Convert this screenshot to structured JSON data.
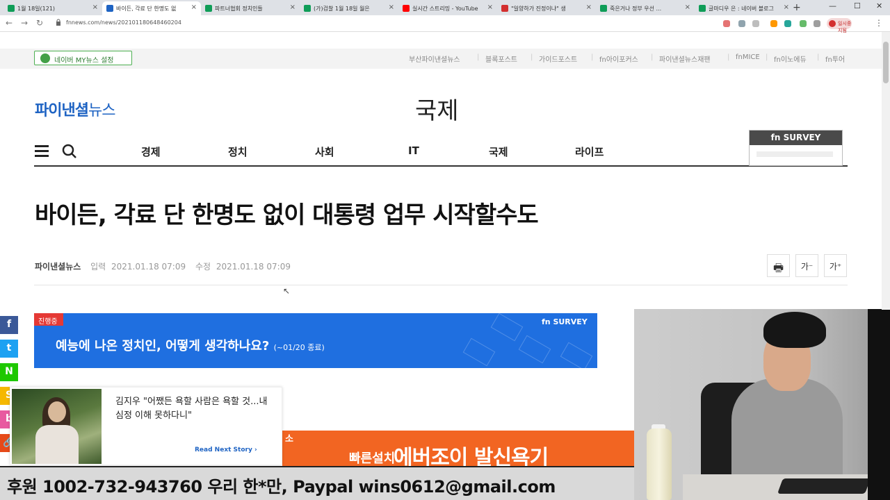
{
  "browser": {
    "tabs": [
      {
        "label": "1월 18일(121)",
        "color": "#0f9d58"
      },
      {
        "label": "바이든, 각료 단 한명도 없",
        "color": "#1e63c3",
        "active": true
      },
      {
        "label": "파트너협회 정치인들",
        "color": "#0f9d58"
      },
      {
        "label": "(가)검찰 1월 18일 월은",
        "color": "#0f9d58"
      },
      {
        "label": "실시간 스트리밍 - YouTube",
        "color": "#ff0000"
      },
      {
        "label": "\"일양하가 진정이냐\" 생",
        "color": "#d32f2f"
      },
      {
        "label": "죽은거나 정부 우선 ...",
        "color": "#0f9d58"
      },
      {
        "label": "글마디우 은 : 네이버 블로그",
        "color": "#0f9d58"
      }
    ],
    "new_tab": "+",
    "url": "fnnews.com/news/202101180648460204",
    "profile_label": "일시중지됨",
    "controls": {
      "min": "—",
      "max": "☐",
      "close": "✕"
    }
  },
  "site": {
    "mynews_label": "네이버 MY뉴스 설정",
    "top_links": [
      "부산파이낸셜뉴스",
      "블록포스트",
      "가이드포스트",
      "fn아이포커스",
      "파이낸셜뉴스재팬",
      "fnMICE",
      "fn이노에듀",
      "fn투어"
    ],
    "logo_bold": "파이낸셜",
    "logo_light": "뉴스",
    "section_title": "국제",
    "nav": [
      "경제",
      "정치",
      "사회",
      "IT",
      "국제",
      "라이프"
    ],
    "survey_logo": "fn SURVEY"
  },
  "article": {
    "headline": "바이든, 각료 단 한명도 없이 대통령 업무 시작할수도",
    "source": "파이낸셜뉴스",
    "input_label": "입력",
    "input_time": "2021.01.18 07:09",
    "edit_label": "수정",
    "edit_time": "2021.01.18 07:09",
    "tools": {
      "print": "🖶",
      "font_down": "가⁻",
      "font_up": "가⁺"
    }
  },
  "survey_banner": {
    "badge": "진행중",
    "question": "예능에 나온 정치인, 어떻게 생각하나요?",
    "period": "(~01/20 종료)",
    "logo": "fn SURVEY"
  },
  "social": [
    {
      "name": "facebook",
      "glyph": "f",
      "color": "#3b5998"
    },
    {
      "name": "twitter",
      "glyph": "t",
      "color": "#1da1f2"
    },
    {
      "name": "naver",
      "glyph": "N",
      "color": "#1ec800"
    },
    {
      "name": "kakaostory",
      "glyph": "S",
      "color": "#f5b800"
    },
    {
      "name": "band",
      "glyph": "b",
      "color": "#e85aa0"
    },
    {
      "name": "link",
      "glyph": "🔗",
      "color": "#e64a19"
    }
  ],
  "read_next": {
    "title": "김지우 \"어쨌든 욕할 사람은 욕할 것...내 심정 이해 못하다니\"",
    "link": "Read Next Story ›"
  },
  "ad": {
    "small1": "소",
    "small2": "빠른설치",
    "big": "에버조이 발신욕기"
  },
  "donation": {
    "text": "후원 1002-732-943760 우리 한*만, Paypal wins0612@gmail.com"
  }
}
